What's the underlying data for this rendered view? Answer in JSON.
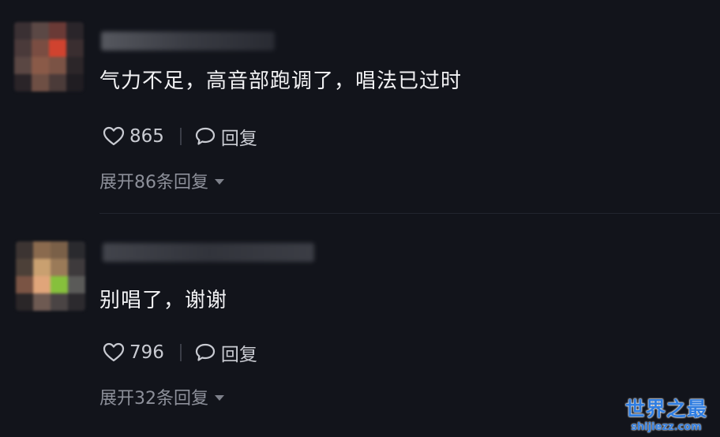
{
  "comments": [
    {
      "text": "气力不足，高音部跑调了，唱法已过时",
      "likes": "865",
      "reply_label": "回复",
      "expand_label": "展开86条回复",
      "avatar_colors": [
        "#3a3033",
        "#5b4845",
        "#6a3a36",
        "#2a252a",
        "#4a3a3a",
        "#7a4d42",
        "#d0432f",
        "#3a2e30",
        "#5a4743",
        "#8a5a48",
        "#7b5345",
        "#2c2629",
        "#2a2428",
        "#6e4f44",
        "#4b3b39",
        "#201d22"
      ],
      "username_blur_colors": [
        "#8e9097",
        "#5a5c64",
        "#3c3e46"
      ]
    },
    {
      "text": "别唱了，谢谢",
      "likes": "796",
      "reply_label": "回复",
      "expand_label": "展开32条回复",
      "avatar_colors": [
        "#3c3432",
        "#8a6a4e",
        "#7a6048",
        "#2a2a2e",
        "#4c4038",
        "#c9a070",
        "#9a7a58",
        "#3e3a3c",
        "#7a5444",
        "#e0a57a",
        "#86c03c",
        "#5a5a58",
        "#2a2628",
        "#6e5a52",
        "#4a4444",
        "#2c2a2e"
      ],
      "username_blur_colors": [
        "#6a6c74",
        "#4c4e56",
        "#5e6068"
      ]
    }
  ],
  "watermark": {
    "title": "世界之最",
    "url": "shijiezz.com"
  }
}
